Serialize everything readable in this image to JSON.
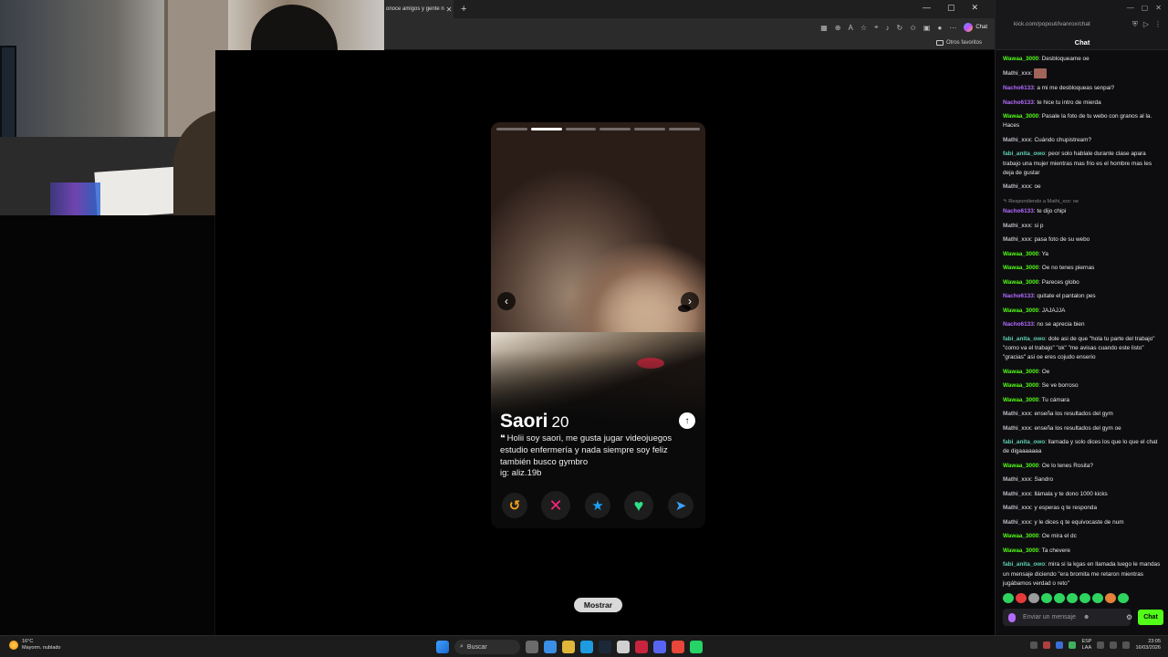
{
  "browser": {
    "tab_title": "onoce amigos y gente n",
    "tab_close": "✕",
    "new_tab": "+",
    "window_controls": [
      "—",
      "▢",
      "✕"
    ],
    "chat_button_label": "Chat",
    "favorites_label": "Otros favoritos"
  },
  "profile": {
    "name": "Saori",
    "age": "20",
    "bio_mark": "❝",
    "bio": "Holii soy saori, me gusta jugar videojuegos estudio enfermería y nada siempre soy feliz también busco gymbro",
    "handle": "ig: aliz.19b",
    "photo_segments_total": 6,
    "photo_segment_active": 2
  },
  "card_controls": {
    "prev": "‹",
    "next": "›",
    "info": "↑",
    "rewind": "↺",
    "nope": "✕",
    "super_like": "★",
    "like": "♥",
    "boost": "➤"
  },
  "mostrar_label": "Mostrar",
  "chat": {
    "url": "kick.com/popout/ivanrox/chat",
    "title": "Chat",
    "input_placeholder": "Enviar un mensaje",
    "send_label": "Chat",
    "settings_icon": "⚙",
    "window_controls": [
      "—",
      "▢",
      "✕"
    ],
    "colors": {
      "green": "#53fc18",
      "grey": "#b9b9c0",
      "purple": "#b36bff",
      "teal": "#5fd0b5"
    },
    "messages": [
      {
        "user": "Wawaa_3000",
        "color": "green",
        "text": "Desbloqueame oe"
      },
      {
        "user": "Mathi_xxx",
        "color": "grey",
        "text": "",
        "image": true
      },
      {
        "user": "Nacho6133",
        "color": "purple",
        "text": "a mi me desbloqueas senpai?"
      },
      {
        "user": "Nacho6133",
        "color": "purple",
        "text": "te hice tu intro de mierda"
      },
      {
        "user": "Wawaa_3000",
        "color": "green",
        "text": "Pasale la foto de tu webo con granos al la. Haces"
      },
      {
        "user": "Mathi_xxx",
        "color": "grey",
        "text": "Cuándo chupistream?"
      },
      {
        "user": "fabi_anita_owo",
        "color": "teal",
        "text": "peor solo hablale durante clase apara trabajo una mujer mientras mas frio es el hombre mas les deja de gustar"
      },
      {
        "user": "Mathi_xxx",
        "color": "grey",
        "text": "oe"
      },
      {
        "user": "Nacho6133",
        "color": "purple",
        "text": "te dijo chipi",
        "reply": "↰ Respondiendo a Mathi_xxx: oe"
      },
      {
        "user": "Mathi_xxx",
        "color": "grey",
        "text": "si p"
      },
      {
        "user": "Mathi_xxx",
        "color": "grey",
        "text": "pasa foto de su webo"
      },
      {
        "user": "Wawaa_3000",
        "color": "green",
        "text": "Ya"
      },
      {
        "user": "Wawaa_3000",
        "color": "green",
        "text": "Oe no tenes piernas"
      },
      {
        "user": "Wawaa_3000",
        "color": "green",
        "text": "Pareces globo"
      },
      {
        "user": "Nacho6133",
        "color": "purple",
        "text": "quitate el pantalon pes"
      },
      {
        "user": "Wawaa_3000",
        "color": "green",
        "text": "JAJAJJA"
      },
      {
        "user": "Nacho6133",
        "color": "purple",
        "text": "no se aprecia bien"
      },
      {
        "user": "fabi_anita_owo",
        "color": "teal",
        "text": "dole asi de que \"hola tu parte del trabajo\" \"como va el trabajo\" \"ok\" \"me avisas cuando este listo\" \"gracias\" asi oe eres cojudo enserio"
      },
      {
        "user": "Wawaa_3000",
        "color": "green",
        "text": "Oe"
      },
      {
        "user": "Wawaa_3000",
        "color": "green",
        "text": "Se ve borroso"
      },
      {
        "user": "Wawaa_3000",
        "color": "green",
        "text": "Tu cámara"
      },
      {
        "user": "Mathi_xxx",
        "color": "grey",
        "text": "enseña los resultados del gym"
      },
      {
        "user": "Mathi_xxx",
        "color": "grey",
        "text": "enseña los resultados del gym oe"
      },
      {
        "user": "fabi_anita_owo",
        "color": "teal",
        "text": "llamada y solo dices los que lo que el chat de digaaaaaaa"
      },
      {
        "user": "Wawaa_3000",
        "color": "green",
        "text": "Oe lo tenes Rosita?"
      },
      {
        "user": "Mathi_xxx",
        "color": "grey",
        "text": "Sandro"
      },
      {
        "user": "Mathi_xxx",
        "color": "grey",
        "text": "llámala y te dono 1000 kicks"
      },
      {
        "user": "Mathi_xxx",
        "color": "grey",
        "text": "y esperas q te responda"
      },
      {
        "user": "Mathi_xxx",
        "color": "grey",
        "text": "y le dices q te equivocaste de num"
      },
      {
        "user": "Wawaa_3000",
        "color": "green",
        "text": "Oe mira el dc"
      },
      {
        "user": "Wawaa_3000",
        "color": "green",
        "text": "Ta chevere"
      },
      {
        "user": "fabi_anita_owo",
        "color": "teal",
        "text": "mira si la kgas en llamada luego le mandas un mensaje diciendo \"era bromita me retaron mientras jugábamos verdad o reto\""
      }
    ]
  },
  "taskbar": {
    "temperature": "16°C",
    "weather": "Mayorm. nublado",
    "search_label": "Buscar",
    "lang_1": "ESP",
    "lang_2": "LAA",
    "time": "23:05",
    "date": "16/03/2026"
  }
}
